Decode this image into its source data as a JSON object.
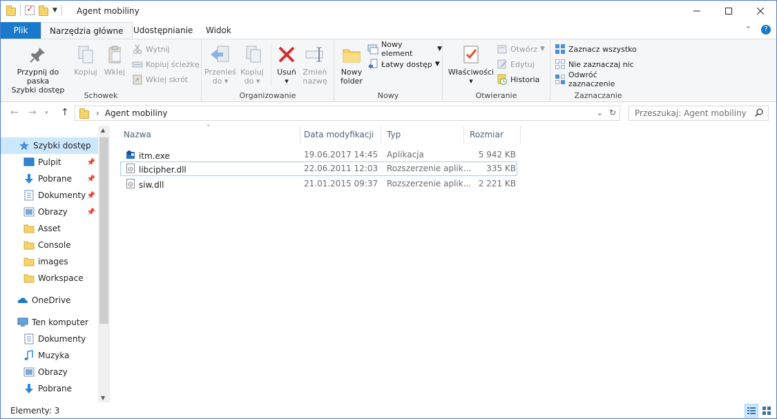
{
  "window": {
    "title": "Agent mobiliny"
  },
  "tabs": {
    "file": "Plik",
    "home": "Narzędzia główne",
    "share": "Udostępnianie",
    "view": "Widok"
  },
  "ribbon": {
    "clipboard": {
      "label": "Schowek",
      "pin_line1": "Przypnij do paska",
      "pin_line2": "Szybki dostęp",
      "copy": "Kopiuj",
      "paste": "Wklej",
      "cut": "Wytnij",
      "copy_path": "Kopiuj ścieżkę",
      "paste_shortcut": "Wklej skrót"
    },
    "organize": {
      "label": "Organizowanie",
      "move_line1": "Przenieś",
      "move_line2": "do",
      "copy_line1": "Kopiuj",
      "copy_line2": "do",
      "delete": "Usuń",
      "rename_line1": "Zmień",
      "rename_line2": "nazwę"
    },
    "new": {
      "label": "Nowy",
      "folder_line1": "Nowy",
      "folder_line2": "folder",
      "new_item": "Nowy element",
      "easy_access": "Łatwy dostęp"
    },
    "open": {
      "label": "Otwieranie",
      "properties": "Właściwości",
      "open": "Otwórz",
      "edit": "Edytuj",
      "history": "Historia"
    },
    "select": {
      "label": "Zaznaczanie",
      "select_all": "Zaznacz wszystko",
      "select_none": "Nie zaznaczaj nic",
      "invert": "Odwróć zaznaczenie"
    }
  },
  "address": {
    "path": "Agent mobiliny",
    "search_placeholder": "Przeszukaj: Agent mobiliny"
  },
  "nav": {
    "quick_access": "Szybki dostęp",
    "items": [
      {
        "label": "Pulpit",
        "icon": "desktop-icon",
        "pinned": true
      },
      {
        "label": "Pobrane",
        "icon": "download-icon",
        "pinned": true
      },
      {
        "label": "Dokumenty",
        "icon": "documents-icon",
        "pinned": true
      },
      {
        "label": "Obrazy",
        "icon": "pictures-icon",
        "pinned": true
      },
      {
        "label": "Asset",
        "icon": "folder-icon",
        "pinned": false
      },
      {
        "label": "Console",
        "icon": "folder-icon",
        "pinned": false
      },
      {
        "label": "images",
        "icon": "folder-icon",
        "pinned": false
      },
      {
        "label": "Workspace",
        "icon": "folder-icon",
        "pinned": false
      }
    ],
    "onedrive": "OneDrive",
    "this_pc": "Ten komputer",
    "pc_items": [
      {
        "label": "Dokumenty",
        "icon": "documents-icon"
      },
      {
        "label": "Muzyka",
        "icon": "music-icon"
      },
      {
        "label": "Obrazy",
        "icon": "pictures-icon"
      },
      {
        "label": "Pobrane",
        "icon": "download-icon"
      }
    ]
  },
  "columns": {
    "name": "Nazwa",
    "date": "Data modyfikacji",
    "type": "Typ",
    "size": "Rozmiar"
  },
  "files": [
    {
      "name": "itm.exe",
      "date": "19.06.2017 14:45",
      "type": "Aplikacja",
      "size": "5 942 KB",
      "icon": "exe-icon"
    },
    {
      "name": "libcipher.dll",
      "date": "22.06.2011 12:03",
      "type": "Rozszerzenie aplik...",
      "size": "335 KB",
      "icon": "dll-icon"
    },
    {
      "name": "siw.dll",
      "date": "21.01.2015 09:37",
      "type": "Rozszerzenie aplik...",
      "size": "2 221 KB",
      "icon": "dll-icon"
    }
  ],
  "status": {
    "count": "Elementy: 3"
  },
  "colors": {
    "accent": "#1979ca",
    "selection": "#cce8ff",
    "delete_red": "#d32f2f"
  }
}
